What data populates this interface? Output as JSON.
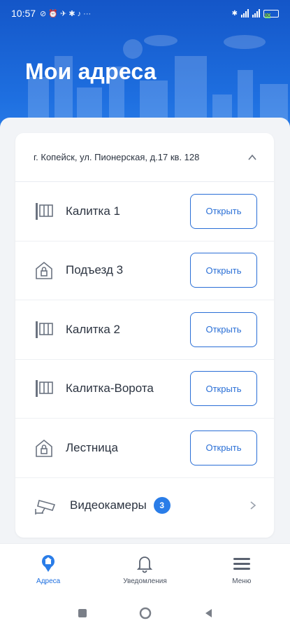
{
  "status_bar": {
    "time": "10:57",
    "battery_level": "80"
  },
  "header": {
    "title": "Мои адреса"
  },
  "address": {
    "text": "г. Копейск, ул. Пионерская, д.17 кв. 128",
    "expanded": true
  },
  "access_points": [
    {
      "label": "Калитка 1",
      "icon": "gate-icon",
      "button": "Открыть"
    },
    {
      "label": "Подъезд 3",
      "icon": "entrance-lock-icon",
      "button": "Открыть"
    },
    {
      "label": "Калитка 2",
      "icon": "gate-icon",
      "button": "Открыть"
    },
    {
      "label": "Калитка-Ворота",
      "icon": "gate-icon",
      "button": "Открыть"
    },
    {
      "label": "Лестница",
      "icon": "entrance-lock-icon",
      "button": "Открыть"
    }
  ],
  "cameras": {
    "label": "Видеокамеры",
    "count": "3",
    "icon": "security-camera-icon"
  },
  "bottom_nav": [
    {
      "label": "Адреса",
      "icon": "address-pin-icon",
      "active": true
    },
    {
      "label": "Уведомления",
      "icon": "bell-icon",
      "active": false
    },
    {
      "label": "Меню",
      "icon": "menu-icon",
      "active": false
    }
  ],
  "colors": {
    "accent": "#1e6fe0",
    "header_top": "#1456c8",
    "text": "#2b3340",
    "background": "#f2f4f7"
  }
}
